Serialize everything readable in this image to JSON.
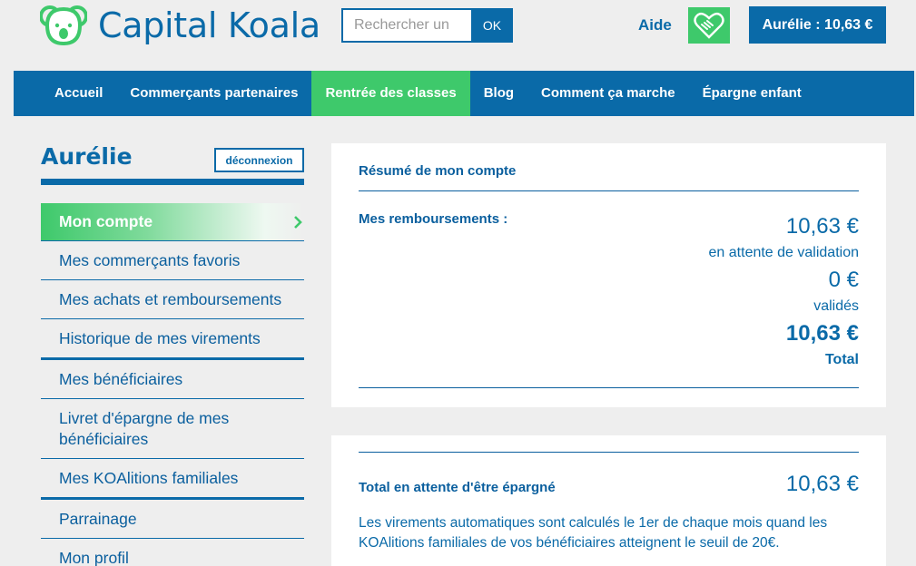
{
  "header": {
    "logo_text": "Capital Koala",
    "search_placeholder": "Rechercher un",
    "search_button": "OK",
    "help_link": "Aide",
    "account_button": "Aurélie : 10,63 €"
  },
  "nav": {
    "items": [
      {
        "label": "Accueil"
      },
      {
        "label": "Commerçants partenaires"
      },
      {
        "label": "Rentrée des classes"
      },
      {
        "label": "Blog"
      },
      {
        "label": "Comment ça marche"
      },
      {
        "label": "Épargne enfant"
      }
    ],
    "active_index": 2
  },
  "sidebar": {
    "user_name": "Aurélie",
    "logout_button": "déconnexion",
    "items": [
      {
        "label": "Mon compte"
      },
      {
        "label": "Mes commerçants favoris"
      },
      {
        "label": "Mes achats et remboursements"
      },
      {
        "label": "Historique de mes virements"
      },
      {
        "label": "Mes bénéficiaires"
      },
      {
        "label": "Livret d'épargne de mes bénéficiaires"
      },
      {
        "label": "Mes KOAlitions familiales"
      },
      {
        "label": "Parrainage"
      },
      {
        "label": "Mon profil"
      }
    ]
  },
  "summary": {
    "title": "Résumé de mon compte",
    "refunds_label": "Mes remboursements :",
    "pending_amount": "10,63 €",
    "pending_label": "en attente de validation",
    "validated_amount": "0 €",
    "validated_label": "validés",
    "total_amount": "10,63 €",
    "total_label": "Total"
  },
  "savings": {
    "label": "Total en attente d'être épargné",
    "amount": "10,63 €",
    "info": "Les virements automatiques sont calculés le 1er de chaque mois quand les KOAlitions familiales de vos bénéficiaires atteignent le seuil de 20€."
  },
  "colors": {
    "brand_blue": "#0a6aa8",
    "brand_green": "#3ec96b",
    "background": "#eeeeee"
  }
}
